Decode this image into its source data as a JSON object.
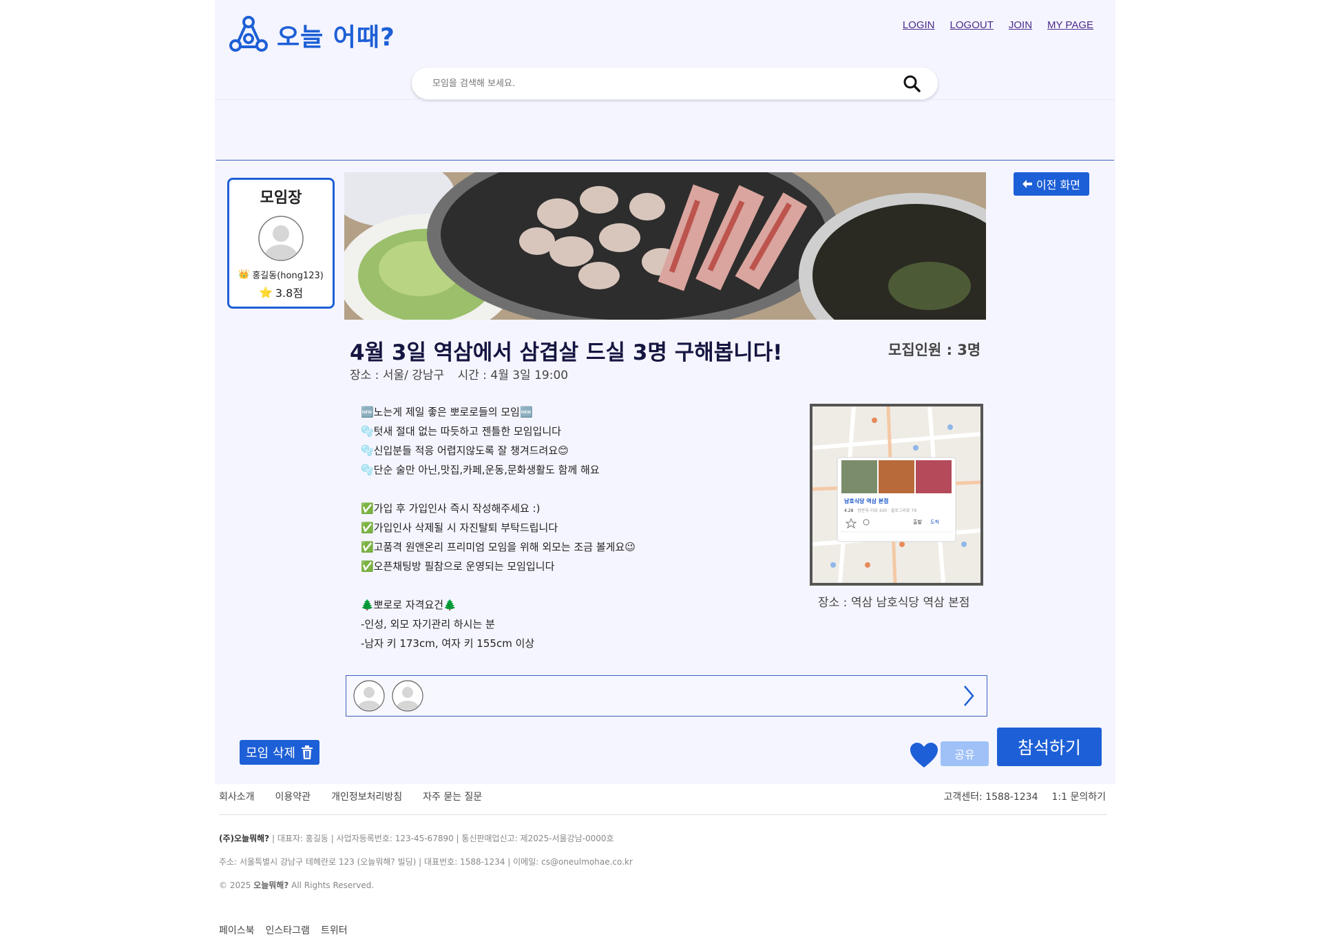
{
  "header": {
    "logo_text": "오늘 어때?",
    "nav": [
      "LOGIN",
      "LOGOUT",
      "JOIN",
      "MY PAGE"
    ],
    "search_placeholder": "모임을 검색해 보세요."
  },
  "host": {
    "title": "모임장",
    "name": "홍길동(hong123)",
    "rating": "3.8점"
  },
  "back_button": "이전 화면",
  "meeting": {
    "title": "4월 3일 역삼에서 삼겹살 드실 3명 구해봅니다!",
    "recruit": "모집인원 : 3명",
    "place_label": "장소 : 서울/ 강남구",
    "time_label": "시간 :  4월 3일 19:00",
    "description": [
      "🆕노는게 제일 좋은 뽀로로들의 모임🆕",
      "🫧텃새 절대 없는 따듯하고 젠틀한 모임입니다",
      "🫧신입분들 적응 어렵지않도록 잘 챙겨드려요😊",
      "🫧단순 술만 아닌,맛집,카페,운동,문화생활도 함께 해요",
      "",
      "✅가입 후 가입인사 즉시 작성해주세요 :)",
      "✅가입인사 삭제될 시 자진탈퇴 부탁드립니다",
      "✅고품격 원앤온리 프리미엄 모임을 위해 외모는 조금 볼게요😉",
      "✅오픈채팅방 필참으로 운영되는 모임입니다",
      "",
      "🌲뽀로로 자격요건🌲",
      "-인성, 외모 자기관리 하시는 분",
      "-남자 키 173cm, 여자 키 155cm 이상"
    ],
    "map_caption": "장소 : 역삼 남호식당 역삼 본점",
    "map_place_name": "남호식당 역삼 본점",
    "map_place_rating": "4.28",
    "map_place_stats": "방문자 리뷰 430 · 블로그리뷰 79",
    "map_actions": [
      "출발",
      "도착"
    ]
  },
  "actions": {
    "delete": "모임 삭제",
    "share": "공유",
    "join": "참석하기"
  },
  "footer": {
    "links": [
      "회사소개",
      "이용약관",
      "개인정보처리방침",
      "자주 묻는 질문"
    ],
    "right": [
      "고객센터: 1588-1234",
      "1:1 문의하기"
    ],
    "company": "(주)오늘뭐해?",
    "line1": " | 대표자: 홍길동 | 사업자등록번호: 123-45-67890 | 통신판매업신고: 제2025-서울강남-0000호",
    "line2": "주소: 서울특별시 강남구 테헤란로 123 (오늘뭐해? 빌딩) | 대표번호: 1588-1234 | 이메일: cs@oneulmohae.co.kr",
    "copyright_prefix": "© 2025 ",
    "copyright_brand": "오늘뭐해?",
    "copyright_suffix": " All Rights Reserved.",
    "sns": [
      "페이스북",
      "인스타그램",
      "트위터"
    ]
  },
  "colors": {
    "accent": "#1d5fd6",
    "share_disabled": "#9fc1f7",
    "page_bg": "#f5f5ff"
  }
}
